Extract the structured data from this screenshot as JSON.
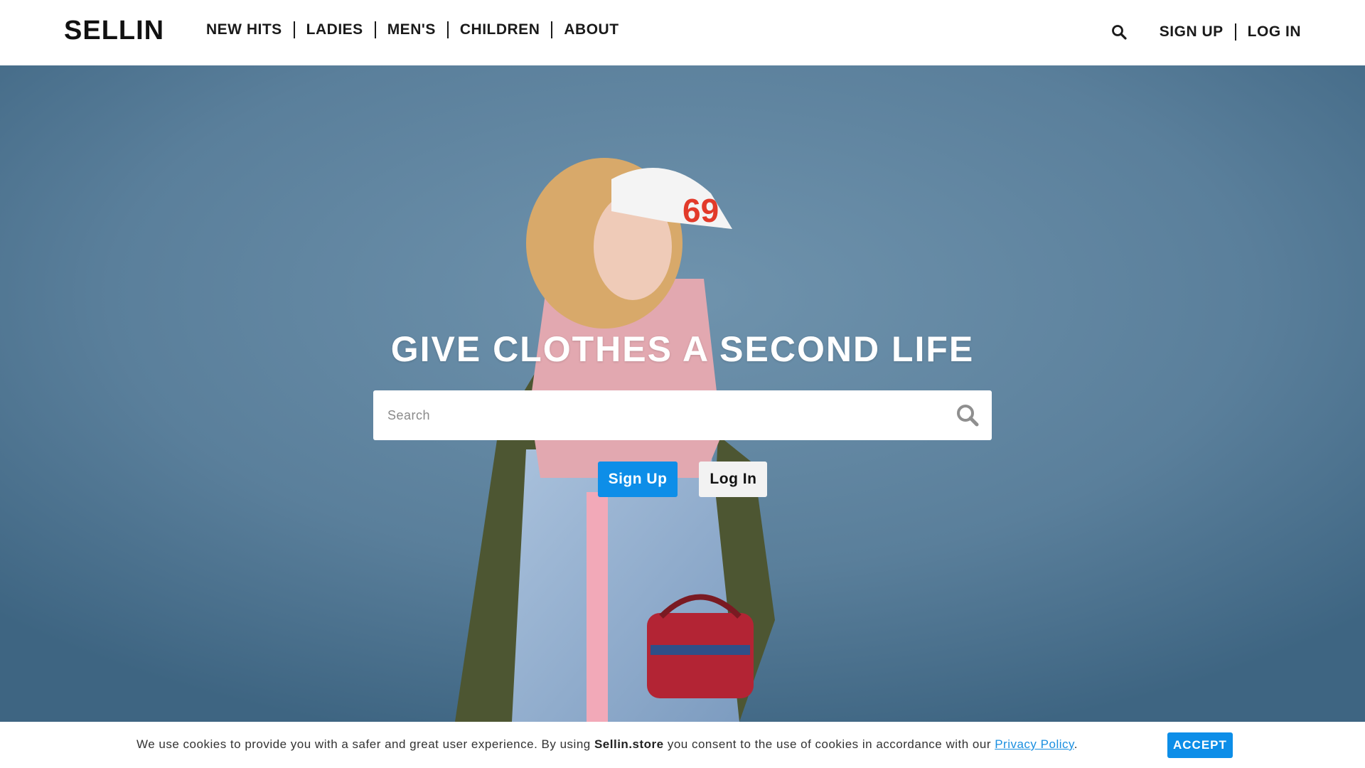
{
  "header": {
    "logo": "SELLIN",
    "nav": [
      {
        "label": "NEW HITS"
      },
      {
        "label": "LADIES"
      },
      {
        "label": "MEN'S"
      },
      {
        "label": "CHILDREN"
      },
      {
        "label": "ABOUT"
      }
    ],
    "search_icon": "search-icon",
    "sign_up_label": "SIGN UP",
    "log_in_label": "LOG IN"
  },
  "hero": {
    "title": "GIVE CLOTHES A SECOND LIFE",
    "search": {
      "placeholder": "Search",
      "value": "",
      "icon": "search-icon"
    },
    "sign_up_button": "Sign Up",
    "log_in_button": "Log In",
    "background_color": "#577c98"
  },
  "cookie_bar": {
    "text_before": "We use cookies to provide you with a safer and great user experience. By using ",
    "site_name": "Sellin.store",
    "text_after": " you consent to the use of cookies in accordance with our ",
    "policy_link": "Privacy Policy",
    "text_end": ".",
    "accept_label": "ACCEPT"
  },
  "colors": {
    "accent": "#0d8ee8",
    "text_dark": "#1a1a1a",
    "link": "#1a8fe0"
  }
}
